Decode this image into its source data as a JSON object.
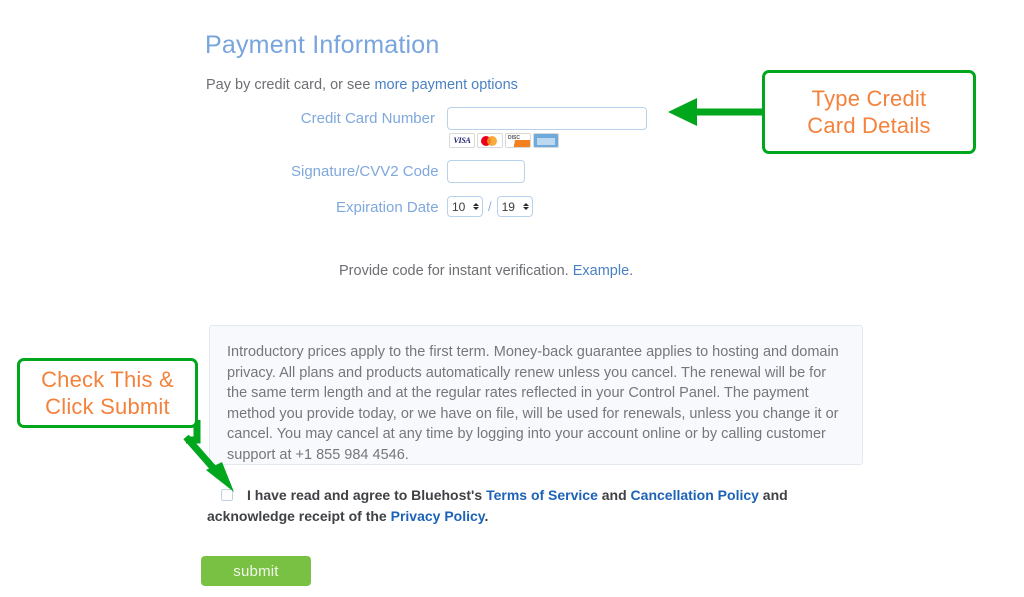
{
  "page": {
    "title": "Payment Information",
    "subtitle_prefix": "Pay by credit card, or see ",
    "subtitle_link": "more payment options"
  },
  "form": {
    "credit_card": {
      "label": "Credit Card Number",
      "value": "",
      "placeholder": ""
    },
    "cvv": {
      "label": "Signature/CVV2 Code",
      "value": "",
      "placeholder": ""
    },
    "expiration": {
      "label": "Expiration Date",
      "month": "10",
      "separator": "/",
      "year": "19"
    },
    "card_brands": [
      "visa-logo",
      "mastercard-logo",
      "discover-logo",
      "amex-logo"
    ],
    "verification_text": "Provide code for instant verification. ",
    "verification_link": "Example",
    "verification_suffix": "."
  },
  "terms": {
    "body": "Introductory prices apply to the first term. Money-back guarantee applies to hosting and domain privacy. All plans and products automatically renew unless you cancel. The renewal will be for the same term length and at the regular rates reflected in your Control Panel. The payment method you provide today, or we have on file, will be used for renewals, unless you change it or cancel. You may cancel at any time by logging into your account online or by calling customer support at +1 855 984 4546."
  },
  "agreement": {
    "checked": false,
    "text_1": "I have read and agree to Bluehost's ",
    "link_terms": "Terms of Service",
    "text_2": " and ",
    "link_cancellation": "Cancellation Policy",
    "text_3": " and acknowledge receipt of the ",
    "link_privacy": "Privacy Policy",
    "text_4": "."
  },
  "submit": {
    "label": "submit"
  },
  "annotations": [
    {
      "id": "credit",
      "line_1": "Type Credit",
      "line_2": "Card Details"
    },
    {
      "id": "check",
      "line_1": "Check This &",
      "line_2": "Click Submit"
    }
  ],
  "colors": {
    "heading_blue": "#78a5dd",
    "label_blue": "#7fa8dc",
    "link_blue": "#4a81c4",
    "strong_link_blue": "#1c63b8",
    "annotation_border_green": "#00a71c",
    "annotation_text_orange": "#f4823c",
    "submit_green": "#79c143",
    "panel_background": "#f7f9fc"
  }
}
